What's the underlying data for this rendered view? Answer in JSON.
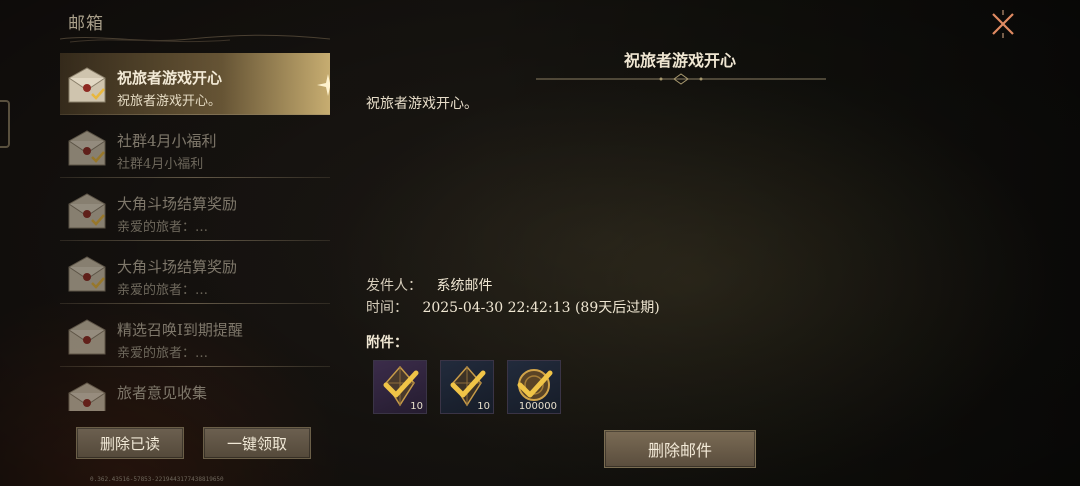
{
  "window": {
    "title": "邮箱"
  },
  "mail_list": [
    {
      "subject": "祝旅者游戏开心",
      "preview": "祝旅者游戏开心。",
      "selected": true,
      "claimed": true
    },
    {
      "subject": "社群4月小福利",
      "preview": "社群4月小福利",
      "selected": false,
      "claimed": true
    },
    {
      "subject": "大角斗场结算奖励",
      "preview": "亲爱的旅者：…",
      "selected": false,
      "claimed": true
    },
    {
      "subject": "大角斗场结算奖励",
      "preview": "亲爱的旅者：…",
      "selected": false,
      "claimed": true
    },
    {
      "subject": "精选召唤Ⅰ到期提醒",
      "preview": "亲爱的旅者：…",
      "selected": false,
      "claimed": false
    },
    {
      "subject": "旅者意见收集",
      "preview": "",
      "selected": false,
      "claimed": false
    }
  ],
  "buttons": {
    "delete_read": "删除已读",
    "claim_all": "一键领取",
    "delete_mail": "删除邮件"
  },
  "version_text": "0.362.43516-57853-2219443177438819650",
  "detail": {
    "title": "祝旅者游戏开心",
    "body": "祝旅者游戏开心。",
    "sender_label": "发件人：",
    "sender_value": "系统邮件",
    "time_label": "时间：",
    "time_value": "2025-04-30 22:42:13 (89天后过期)",
    "attachments_label": "附件："
  },
  "attachments": [
    {
      "icon": "crystal-icon",
      "count": "10",
      "claimed": true
    },
    {
      "icon": "crystal-icon",
      "count": "10",
      "claimed": true
    },
    {
      "icon": "coin-icon",
      "count": "100000",
      "claimed": true
    }
  ],
  "colors": {
    "accent_gold": "#d8b25a",
    "selected_glow": "#e6c882",
    "text_light": "#efe6d2",
    "text_dim": "#7e776a"
  }
}
